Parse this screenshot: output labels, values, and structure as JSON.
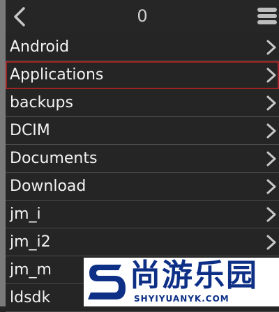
{
  "header": {
    "title": "0",
    "back_icon": "chevron-left-icon",
    "menu_icon": "hamburger-menu-icon"
  },
  "list": {
    "items": [
      {
        "label": "Android"
      },
      {
        "label": "Applications",
        "selected": true
      },
      {
        "label": "backups"
      },
      {
        "label": "DCIM"
      },
      {
        "label": "Documents"
      },
      {
        "label": "Download"
      },
      {
        "label": "jm_i"
      },
      {
        "label": "jm_i2"
      },
      {
        "label": "jm_m"
      },
      {
        "label": "ldsdk"
      }
    ],
    "item_icon": "chevron-right-icon"
  },
  "watermark": {
    "text": "尚游乐园",
    "subtext": "SHYIYUANYK.COM"
  },
  "colors": {
    "background": "#252525",
    "text": "#f2f2f2",
    "selection_border": "#9e2424",
    "watermark_blue": "#0d2f86"
  }
}
